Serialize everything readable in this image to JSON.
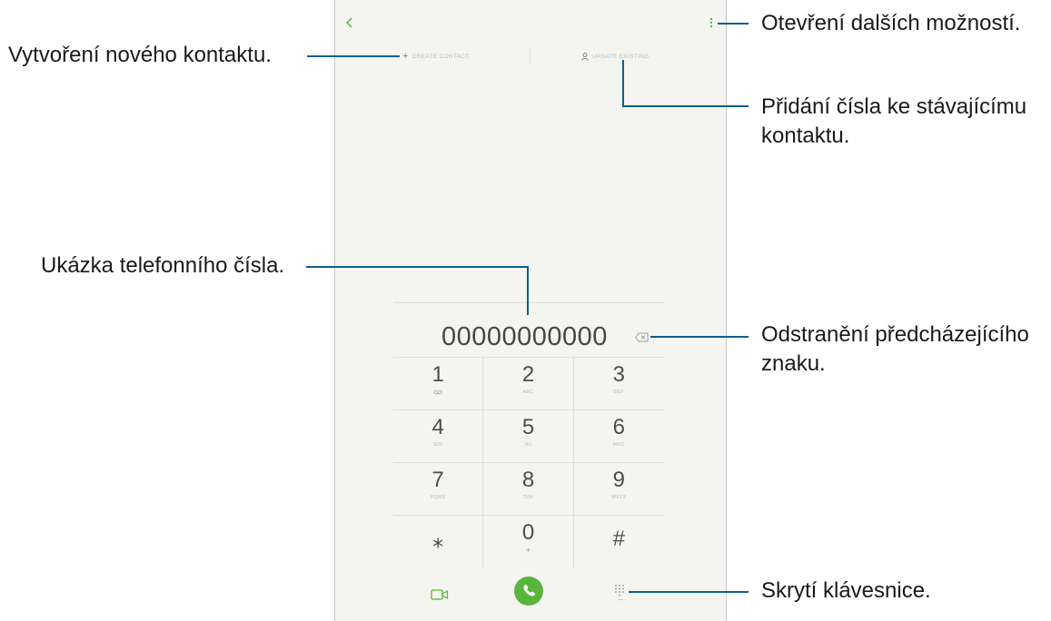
{
  "toolbar": {
    "create_contact": "CREATE CONTACT",
    "update_existing": "UPDATE EXISTING"
  },
  "dialer": {
    "number": "00000000000",
    "keys": [
      {
        "digit": "1",
        "letters": "",
        "sub": "voicemail-icon"
      },
      {
        "digit": "2",
        "letters": "ABC",
        "sub": ""
      },
      {
        "digit": "3",
        "letters": "DEF",
        "sub": ""
      },
      {
        "digit": "4",
        "letters": "GHI",
        "sub": ""
      },
      {
        "digit": "5",
        "letters": "JKL",
        "sub": ""
      },
      {
        "digit": "6",
        "letters": "MNO",
        "sub": ""
      },
      {
        "digit": "7",
        "letters": "PQRS",
        "sub": ""
      },
      {
        "digit": "8",
        "letters": "TUV",
        "sub": ""
      },
      {
        "digit": "9",
        "letters": "WXYZ",
        "sub": ""
      },
      {
        "digit": "⁎",
        "letters": "",
        "sub": ""
      },
      {
        "digit": "0",
        "letters": "",
        "sub": "+"
      },
      {
        "digit": "#",
        "letters": "",
        "sub": ""
      }
    ]
  },
  "callouts": {
    "new_contact": "Vytvoření nového kontaktu.",
    "more_options": "Otevření dalších možností.",
    "add_to_existing_line1": "Přidání čísla ke stávajícímu",
    "add_to_existing_line2": "kontaktu.",
    "number_preview": "Ukázka telefonního čísla.",
    "delete_char_line1": "Odstranění předcházejícího",
    "delete_char_line2": "znaku.",
    "hide_keypad": "Skrytí klávesnice."
  },
  "colors": {
    "accent": "#59b53c",
    "leader": "#0e5f8d",
    "screen_bg": "#f4f5f0"
  }
}
